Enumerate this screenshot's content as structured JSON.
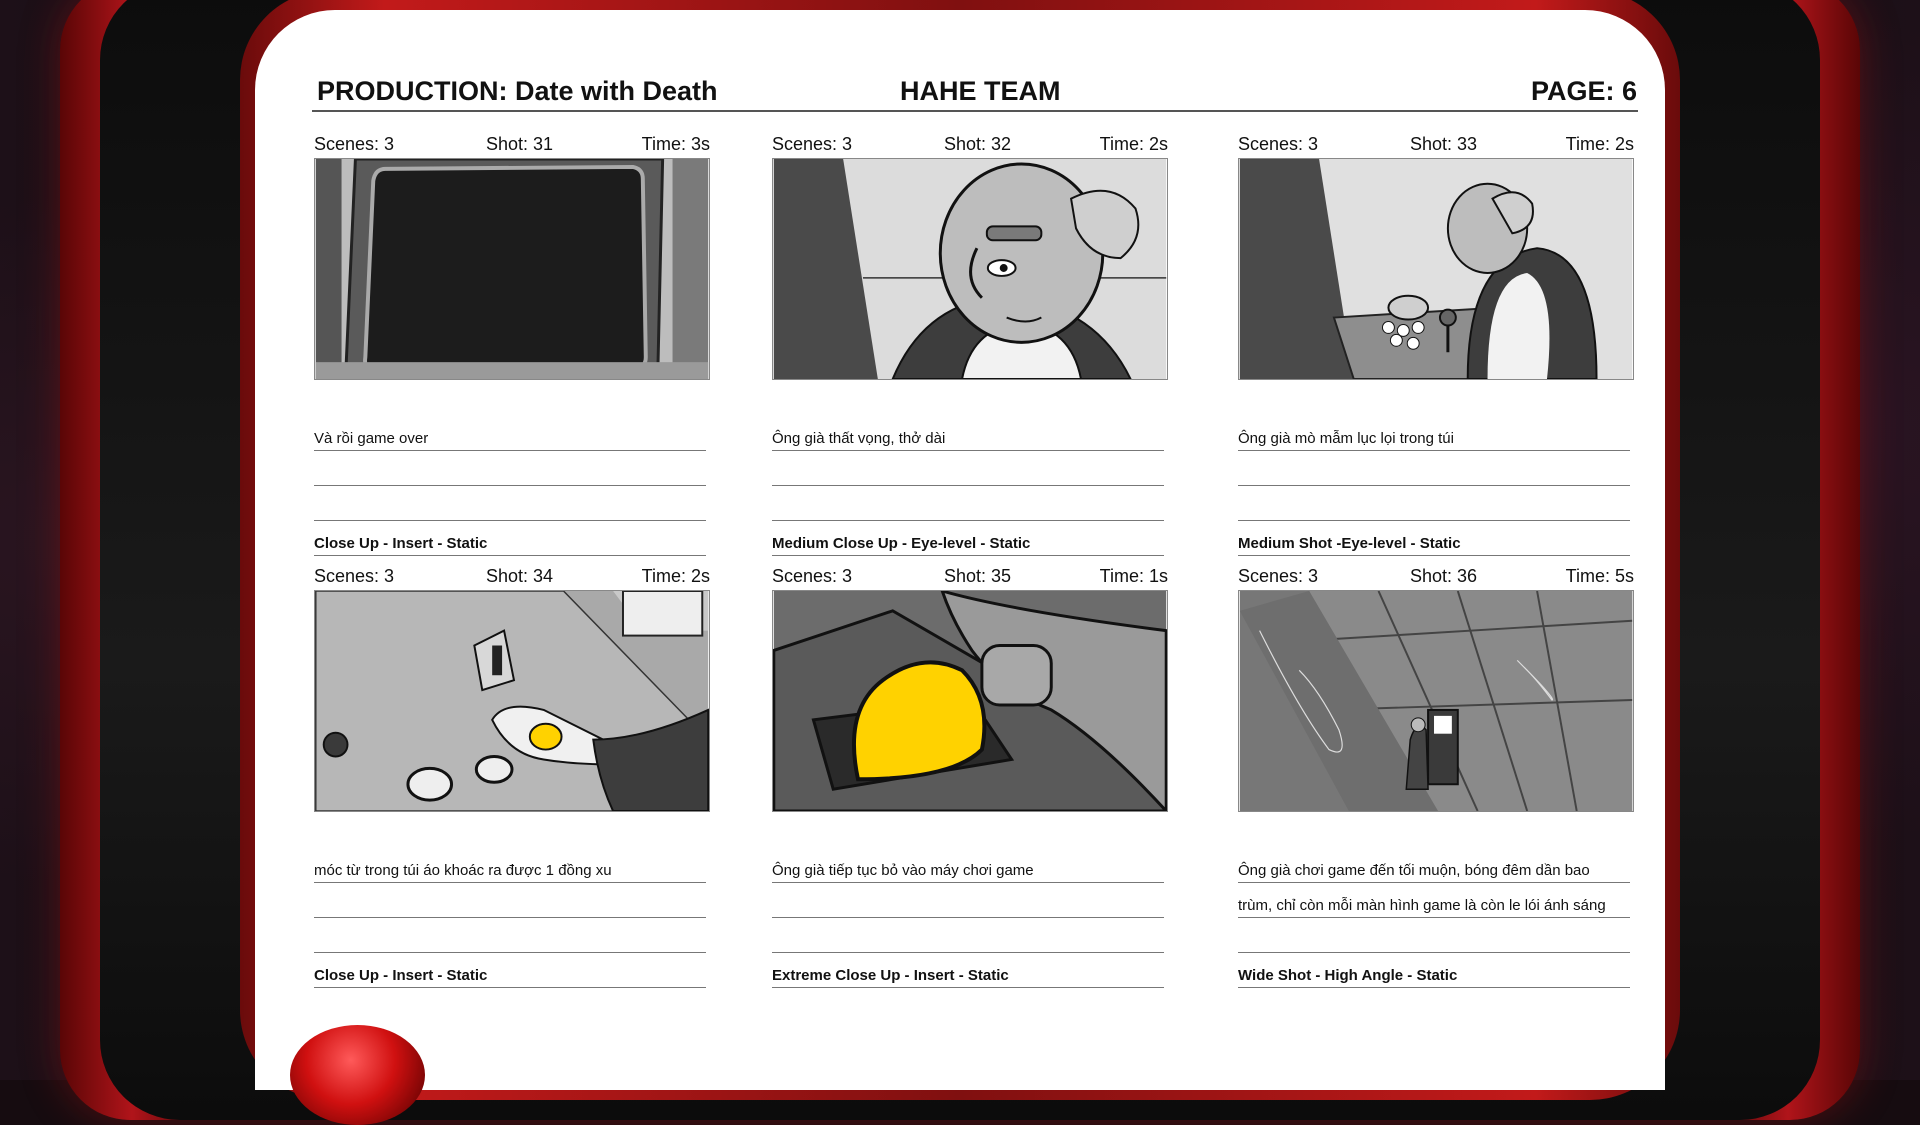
{
  "header": {
    "production": "PRODUCTION: Date with Death",
    "team": "HAHE TEAM",
    "page": "PAGE:  6"
  },
  "panels": [
    {
      "scenes": "Scenes: 3",
      "shot": "Shot: 31",
      "time": "Time: 3s",
      "desc": [
        "Và rồi game over",
        "",
        ""
      ],
      "camera": "Close Up - Insert - Static"
    },
    {
      "scenes": "Scenes: 3",
      "shot": "Shot: 32",
      "time": "Time: 2s",
      "desc": [
        "Ông già thất vọng, thở dài",
        "",
        ""
      ],
      "camera": "Medium Close Up -  Eye-level - Static"
    },
    {
      "scenes": "Scenes: 3",
      "shot": "Shot: 33",
      "time": "Time: 2s",
      "desc": [
        "Ông già mò mẫm lục lọi trong túi",
        "",
        ""
      ],
      "camera": "Medium Shot -Eye-level - Static"
    },
    {
      "scenes": "Scenes: 3",
      "shot": "Shot: 34",
      "time": "Time: 2s",
      "desc": [
        "móc từ trong túi áo khoác ra được 1 đồng xu",
        "",
        ""
      ],
      "camera": "Close Up - Insert - Static"
    },
    {
      "scenes": "Scenes: 3",
      "shot": "Shot: 35",
      "time": "Time: 1s",
      "desc": [
        "Ông già tiếp tục bỏ vào máy chơi game",
        "",
        ""
      ],
      "camera": "Extreme Close Up - Insert - Static"
    },
    {
      "scenes": "Scenes: 3",
      "shot": "Shot: 36",
      "time": "Time: 5s",
      "desc": [
        "Ông già chơi game đến tối muộn, bóng đêm dần bao",
        "trùm, chỉ còn mỗi màn hình game là còn le lói ánh sáng",
        ""
      ],
      "camera": "Wide Shot - High Angle - Static"
    }
  ],
  "colors": {
    "coin": "#ffd200",
    "cabinet_red": "#c21a1a",
    "paper": "#ffffff"
  }
}
